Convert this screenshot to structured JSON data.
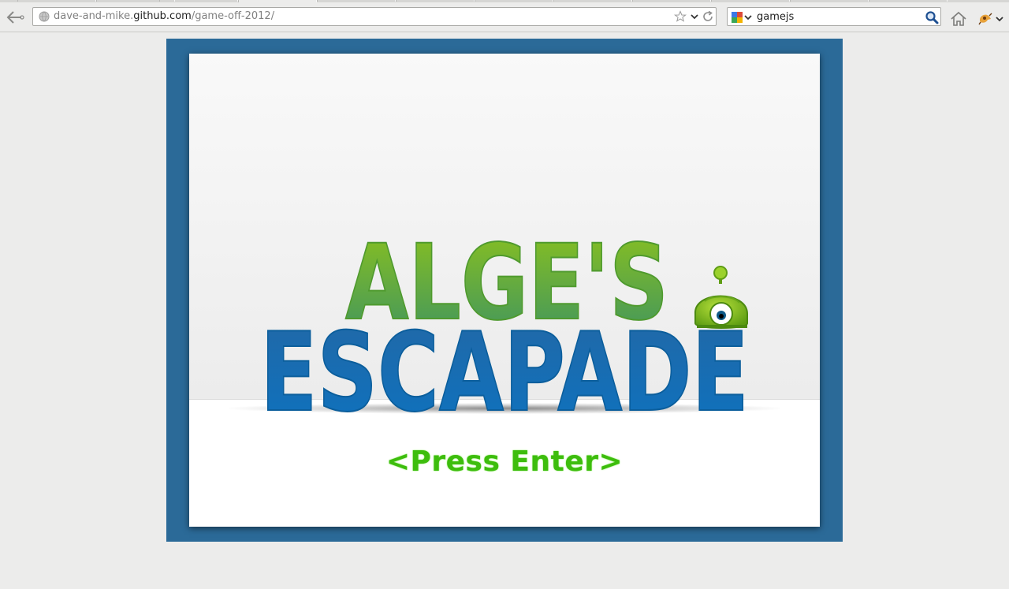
{
  "browser": {
    "url_host_prefix": "dave-and-mike.",
    "url_host": "github.com",
    "url_path": "/game-off-2012/",
    "search_value": "gamejs",
    "icons": {
      "back": "back-arrow-icon",
      "site": "globe-icon",
      "bookmark": "star-icon",
      "history": "chevron-down-icon",
      "reload": "reload-icon",
      "engine": "google-icon",
      "search": "magnifier-icon",
      "home": "home-icon",
      "addon": "addon-icon"
    }
  },
  "game": {
    "title_line1": "ALGE'S",
    "title_line2": "ESCAPADE",
    "prompt": "<Press Enter>"
  },
  "colors": {
    "frame": "#2b6a98",
    "title_green_top": "#8cc21d",
    "title_green_bottom": "#3e9461",
    "title_blue": "#1370b4",
    "prompt_green": "#3dbd0d"
  }
}
